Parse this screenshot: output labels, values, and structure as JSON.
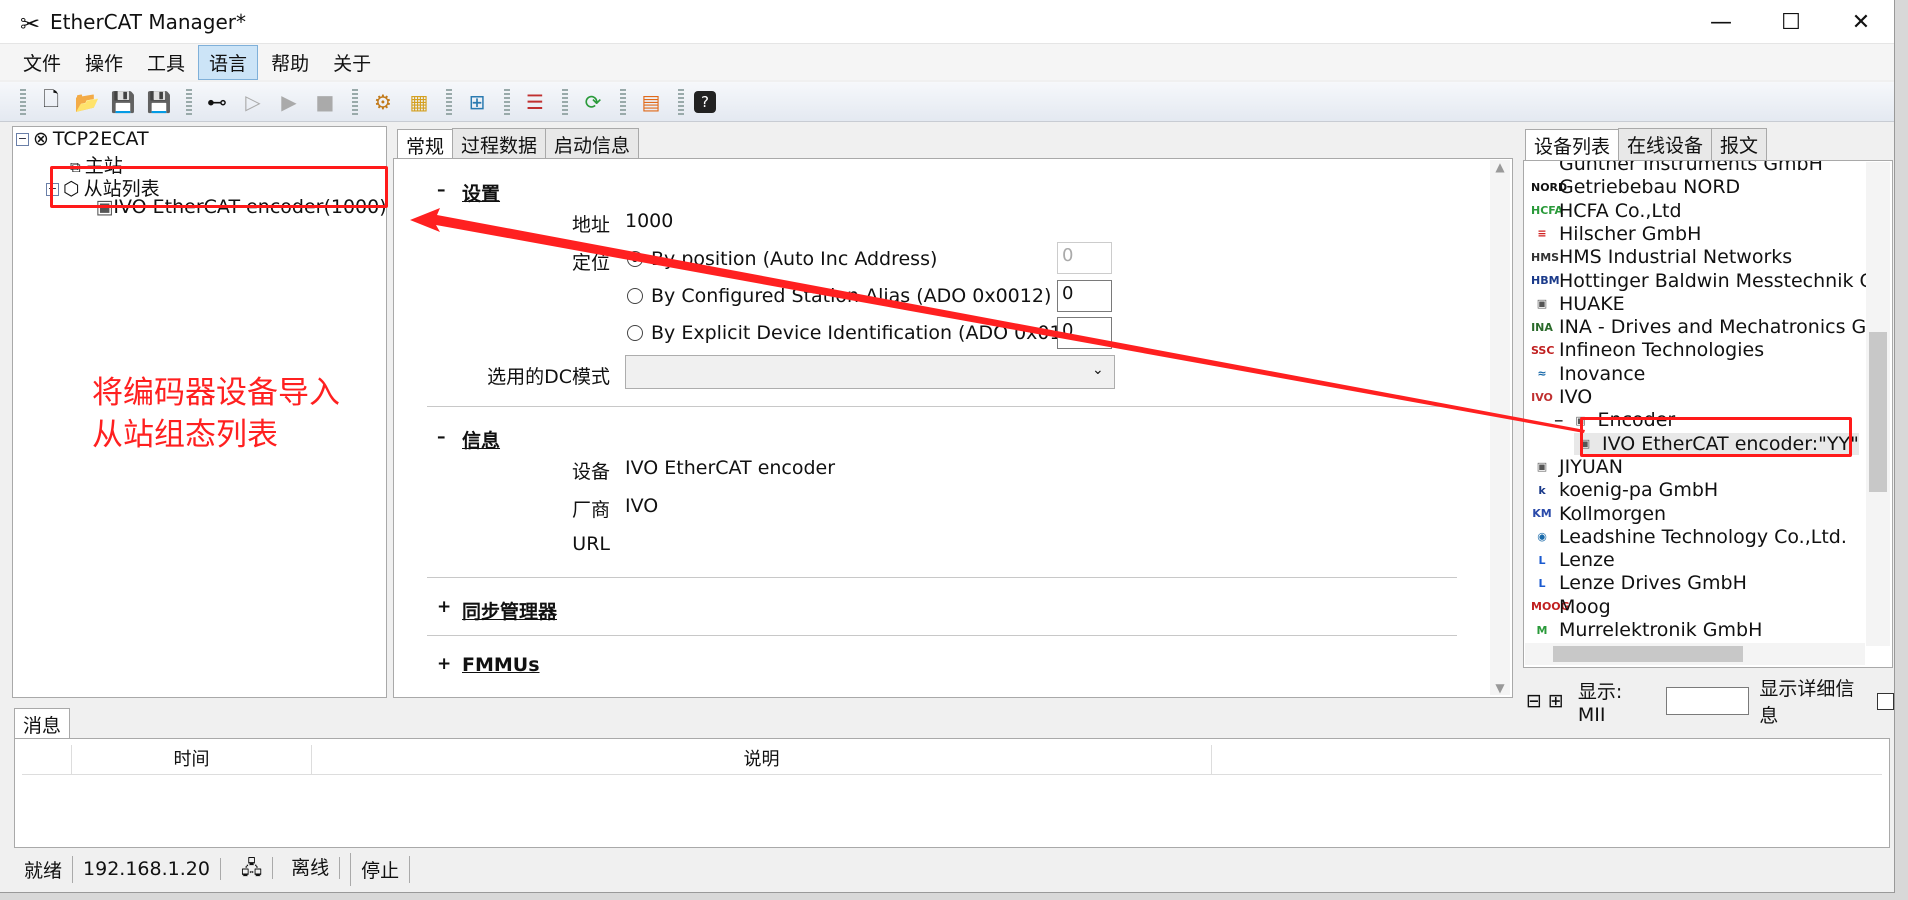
{
  "window": {
    "title": "EtherCAT Manager*"
  },
  "menu": [
    "文件",
    "操作",
    "工具",
    "语言",
    "帮助",
    "关于"
  ],
  "toolbar_icons": [
    "new-file-icon",
    "open-folder-icon",
    "save-icon",
    "save-as-icon",
    "connect-icon",
    "run-icon",
    "play-icon",
    "stop-icon",
    "config-icon",
    "package-icon",
    "network-icon",
    "device-list-icon",
    "refresh-icon",
    "esi-icon",
    "help-icon"
  ],
  "tree": {
    "root": "TCP2ECAT",
    "master": "主站",
    "slave_list": "从站列表",
    "slave_item": "IVO EtherCAT encoder(1000)"
  },
  "center": {
    "tabs": [
      "常规",
      "过程数据",
      "启动信息"
    ],
    "settings": {
      "title": "设置",
      "address_label": "地址",
      "address_value": "1000",
      "position_label": "定位",
      "options": [
        {
          "label": "By position (Auto Inc Address)",
          "value": "0",
          "selected": true
        },
        {
          "label": "By Configured Station Alias (ADO 0x0012)",
          "value": "0",
          "selected": false
        },
        {
          "label": "By Explicit Device Identification (ADO 0x0134)",
          "value": "0",
          "selected": false
        }
      ],
      "dc_label": "选用的DC模式",
      "dc_value": ""
    },
    "info": {
      "title": "信息",
      "device_label": "设备",
      "device_value": "IVO EtherCAT encoder",
      "vendor_label": "厂商",
      "vendor_value": "IVO",
      "url_label": "URL",
      "url_value": ""
    },
    "sync_title": "同步管理器",
    "fmmu_title": "FMMUs",
    "collapse_sign": "–",
    "expand_sign": "+"
  },
  "annotation": {
    "line1": "将编码器设备导入",
    "line2": "从站组态列表"
  },
  "right": {
    "tabs": [
      "设备列表",
      "在线设备",
      "报文"
    ],
    "vendors": [
      {
        "name": "Gunther Instruments GmbH",
        "icon": ""
      },
      {
        "name": "Getriebebau NORD",
        "icon": "NORD"
      },
      {
        "name": "HCFA Co.,Ltd",
        "icon": "HCFA"
      },
      {
        "name": "Hilscher GmbH",
        "icon": "≡"
      },
      {
        "name": "HMS Industrial Networks",
        "icon": "HMS"
      },
      {
        "name": "Hottinger Baldwin Messtechnik Gr",
        "icon": "HBM"
      },
      {
        "name": "HUAKE",
        "icon": "▣"
      },
      {
        "name": "INA - Drives and Mechatronics Gm",
        "icon": "INA"
      },
      {
        "name": "Infineon Technologies",
        "icon": "SSC"
      },
      {
        "name": "Inovance",
        "icon": "≈"
      },
      {
        "name": "IVO",
        "icon": "IVO"
      },
      {
        "name": "Encoder",
        "icon": "▣"
      },
      {
        "name": "IVO EtherCAT encoder:\"YY\"",
        "icon": "▣"
      },
      {
        "name": "JIYUAN",
        "icon": "▣"
      },
      {
        "name": "koenig-pa GmbH",
        "icon": "k"
      },
      {
        "name": "Kollmorgen",
        "icon": "KM"
      },
      {
        "name": "Leadshine Technology Co.,Ltd.",
        "icon": "◉"
      },
      {
        "name": "Lenze",
        "icon": "L"
      },
      {
        "name": "Lenze Drives GmbH",
        "icon": "L"
      },
      {
        "name": "Moog",
        "icon": "MOOG"
      },
      {
        "name": "Murrelektronik GmbH",
        "icon": "M"
      }
    ],
    "bottom": {
      "display_label": "显示: MII",
      "detail_label": "显示详细信息"
    }
  },
  "messages": {
    "tab": "消息",
    "columns": [
      "时间",
      "说明"
    ]
  },
  "status": {
    "state": "就绪",
    "ip": "192.168.1.20",
    "net_state": "离线",
    "run_state": "停止"
  },
  "colors": {
    "annotation_red": "#ff2020",
    "selection": "#cce4f7"
  }
}
